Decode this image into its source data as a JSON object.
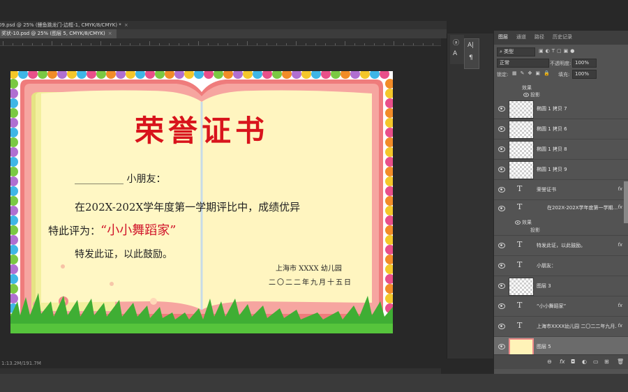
{
  "tabs_row1": [
    {
      "label": "09.psd @ 25% (鲤鱼跳龙门-边框-1, CMYK/8/CMYK) *",
      "close": "×"
    }
  ],
  "tabs_row2": [
    {
      "label": "奖状-10.psd @ 25% (图层 5, CMYK/8/CMYK)",
      "close": "×"
    }
  ],
  "status_text": "1:13.2M/191.7M",
  "certificate": {
    "title": "荣誉证书",
    "recipient_line": "__________ 小朋友：",
    "body_line1": "在202X-202X学年度第一学期评比中，成绩优异",
    "body_line2_prefix": "特此评为：",
    "award_name": "“小小舞蹈家”",
    "body_line3": "特发此证，以此鼓励。",
    "issuer": "上海市 XXXX 幼儿园",
    "date": "二〇二二年九月十五日"
  },
  "mini_panel": {
    "icons": [
      "A|",
      "¶",
      "ⓐ",
      "A"
    ]
  },
  "layers_panel": {
    "tabs": [
      "图层",
      "通道",
      "路径",
      "历史记录"
    ],
    "active_tab": "图层",
    "filter_kind": "类型",
    "blend_mode": "正常",
    "opacity_label": "不透明度:",
    "opacity_value": "100%",
    "lock_label": "锁定:",
    "fill_label": "填充:",
    "fill_value": "100%",
    "effects_top": {
      "effect": "效果",
      "shadow": "投影"
    },
    "layers": [
      {
        "name": "椭圆 1 拷贝 7",
        "type": "pixel",
        "fx": ""
      },
      {
        "name": "椭圆 1 拷贝 6",
        "type": "pixel",
        "fx": ""
      },
      {
        "name": "椭圆 1 拷贝 8",
        "type": "pixel",
        "fx": ""
      },
      {
        "name": "椭圆 1 拷贝 9",
        "type": "pixel",
        "fx": ""
      },
      {
        "name": "荣誉证书",
        "type": "text",
        "fx": "fx"
      },
      {
        "name": "在202X-202X学年度第一学期...",
        "type": "text",
        "fx": "fx"
      },
      {
        "name": "特发此证，以此鼓励。",
        "type": "text",
        "fx": "fx"
      },
      {
        "name": "小朋友：",
        "type": "text",
        "fx": ""
      },
      {
        "name": "图层 3",
        "type": "pixel",
        "fx": ""
      },
      {
        "name": "“小小舞蹈家”",
        "type": "text",
        "fx": "fx"
      },
      {
        "name": "上海市XXXX幼儿园 二〇二二年九月...",
        "type": "text",
        "fx": "fx"
      },
      {
        "name": "图层 5",
        "type": "image",
        "fx": "",
        "selected": true
      }
    ],
    "effects_mid": {
      "effect": "效果",
      "shadow": "投影"
    }
  },
  "colors": {
    "title_red": "#d8141c",
    "award_red": "#d0142a",
    "paper": "#fff6c2",
    "cover_pink": "#ef7c7c",
    "grass": "#3fae34"
  }
}
